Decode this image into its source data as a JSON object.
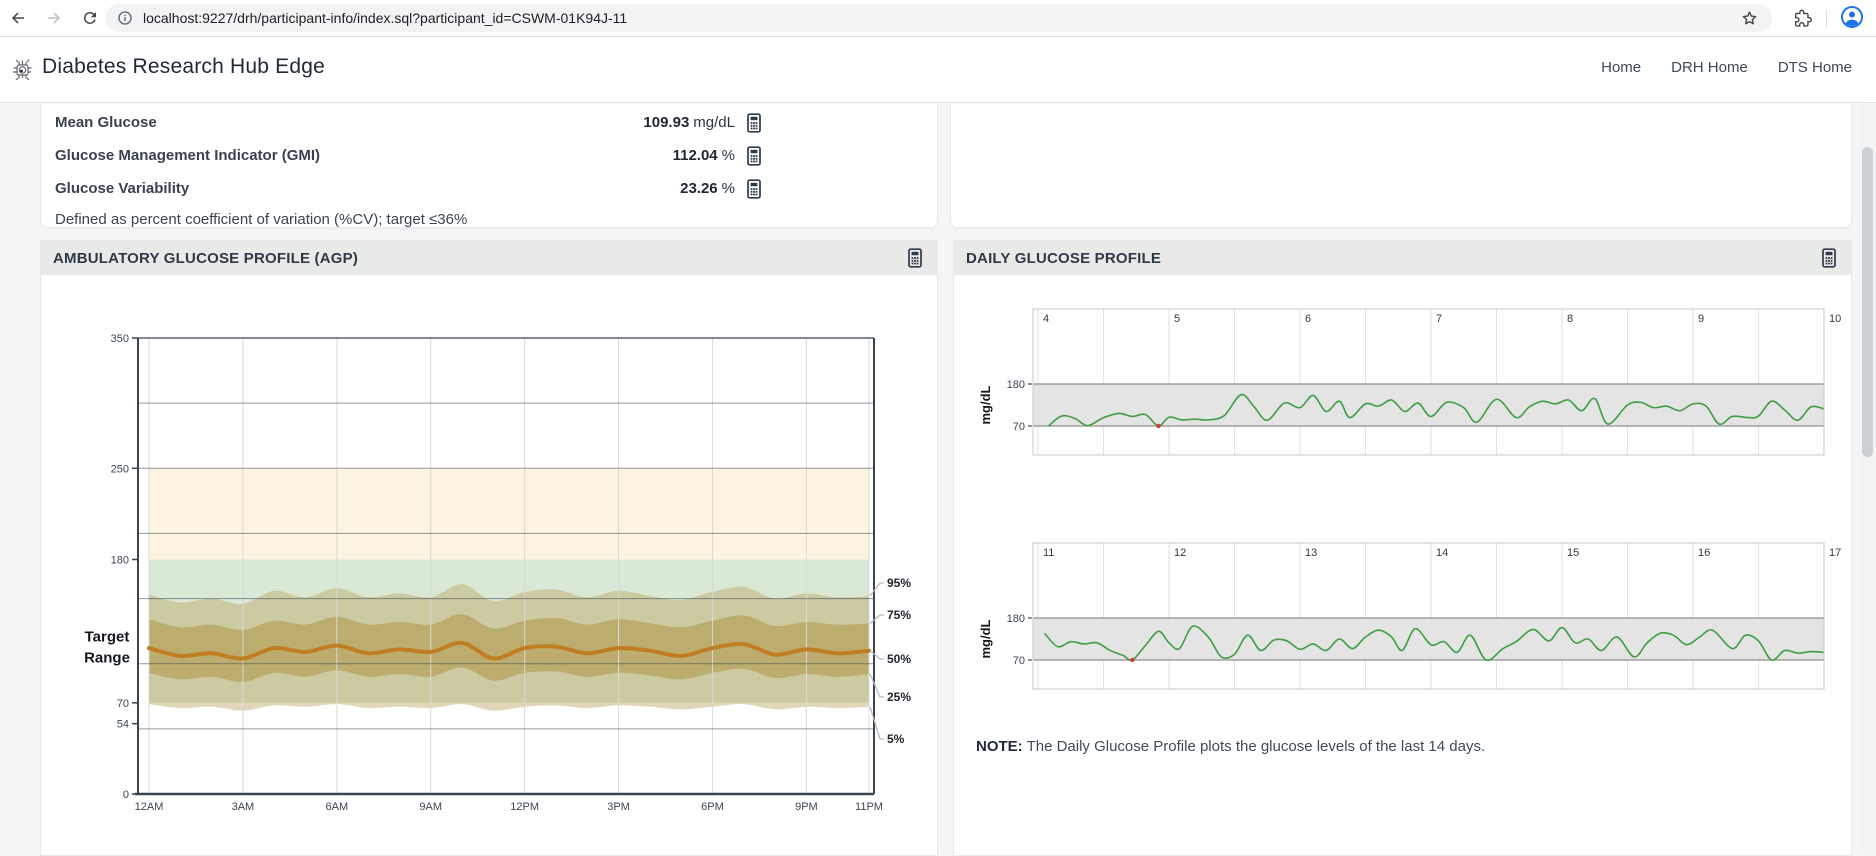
{
  "browser": {
    "url": "localhost:9227/drh/participant-info/index.sql?participant_id=CSWM-01K94J-11",
    "icons": [
      "back-arrow",
      "forward-arrow",
      "reload",
      "site-info",
      "bookmark-star",
      "extensions",
      "profile"
    ]
  },
  "header": {
    "title": "Diabetes Research Hub Edge",
    "logo_icon": "chip-logo",
    "nav": [
      {
        "label": "Home"
      },
      {
        "label": "DRH Home"
      },
      {
        "label": "DTS Home"
      }
    ]
  },
  "metrics": {
    "rows": [
      {
        "label": "Mean Glucose",
        "value": "109.93",
        "unit": "mg/dL",
        "icon": "calculator"
      },
      {
        "label": "Glucose Management Indicator (GMI)",
        "value": "112.04",
        "unit": "%",
        "icon": "calculator"
      },
      {
        "label": "Glucose Variability",
        "value": "23.26",
        "unit": "%",
        "icon": "calculator"
      }
    ],
    "footnote": "Defined as percent coefficient of variation (%CV); target ≤36%"
  },
  "agp_panel": {
    "title": "AMBULATORY GLUCOSE PROFILE (AGP)",
    "header_icon": "calculator"
  },
  "daily_panel": {
    "title": "DAILY GLUCOSE PROFILE",
    "header_icon": "calculator",
    "note_label": "NOTE:",
    "note_text": " The Daily Glucose Profile plots the glucose levels of the last 14 days."
  },
  "colors": {
    "accent_blue": "#1a73e8",
    "daily_line_green": "#3f9e42",
    "median_brown": "#c07d21",
    "target_green_fill": "#d9e9d5",
    "above_target_fill": "#fcf3e1",
    "outer_band_fill": "rgba(188,164,96,0.45)",
    "inner_band_fill": "rgba(172,144,62,0.50)",
    "daily_band_fill": "#e4e4e4",
    "low_point_red": "#d23b3b"
  },
  "chart_data": [
    {
      "id": "agp",
      "type": "area",
      "title": "Ambulatory Glucose Profile (AGP)",
      "x_hours": [
        0,
        1,
        2,
        3,
        4,
        5,
        6,
        7,
        8,
        9,
        10,
        11,
        12,
        13,
        14,
        15,
        16,
        17,
        18,
        19,
        20,
        21,
        22,
        23
      ],
      "xticks": [
        {
          "hour": 0,
          "label": "12AM"
        },
        {
          "hour": 3,
          "label": "3AM"
        },
        {
          "hour": 6,
          "label": "6AM"
        },
        {
          "hour": 9,
          "label": "9AM"
        },
        {
          "hour": 12,
          "label": "12PM"
        },
        {
          "hour": 15,
          "label": "3PM"
        },
        {
          "hour": 18,
          "label": "6PM"
        },
        {
          "hour": 21,
          "label": "9PM"
        },
        {
          "hour": 23,
          "label": "11PM"
        }
      ],
      "ylim": [
        0,
        350
      ],
      "yticks": [
        0,
        54,
        70,
        180,
        250,
        350
      ],
      "gridlines_y": [
        50,
        100,
        150,
        200,
        250,
        300
      ],
      "target_range": [
        70,
        180
      ],
      "above_target_band": [
        180,
        250
      ],
      "target_label": [
        "Target",
        "Range"
      ],
      "percentile_labels": [
        "95%",
        "75%",
        "50%",
        "25%",
        "5%"
      ],
      "series": [
        {
          "name": "5%",
          "values": [
            69,
            66,
            67,
            64,
            68,
            67,
            69,
            66,
            67,
            66,
            69,
            64,
            67,
            68,
            66,
            68,
            67,
            65,
            67,
            69,
            65,
            67,
            66,
            67
          ]
        },
        {
          "name": "25%",
          "values": [
            93,
            88,
            90,
            86,
            93,
            90,
            95,
            90,
            92,
            90,
            97,
            87,
            93,
            94,
            90,
            93,
            91,
            88,
            93,
            96,
            89,
            92,
            90,
            92
          ]
        },
        {
          "name": "50%",
          "values": [
            112,
            106,
            108,
            104,
            112,
            109,
            114,
            108,
            111,
            109,
            116,
            104,
            112,
            113,
            108,
            112,
            110,
            106,
            112,
            115,
            107,
            111,
            108,
            110
          ]
        },
        {
          "name": "75%",
          "values": [
            134,
            128,
            130,
            126,
            133,
            130,
            136,
            130,
            132,
            130,
            138,
            127,
            133,
            135,
            130,
            134,
            131,
            128,
            133,
            137,
            129,
            132,
            130,
            131
          ]
        },
        {
          "name": "95%",
          "values": [
            153,
            147,
            150,
            146,
            156,
            151,
            158,
            151,
            154,
            151,
            161,
            148,
            155,
            157,
            151,
            156,
            152,
            149,
            155,
            159,
            150,
            154,
            151,
            152
          ]
        }
      ]
    },
    {
      "id": "daily-1",
      "type": "line",
      "ylabel": "mg/dL",
      "yticks": [
        70,
        180
      ],
      "target_band": [
        70,
        180
      ],
      "days": [
        4,
        5,
        6,
        7,
        8,
        9,
        10
      ],
      "points": [
        [
          4.08,
          70
        ],
        [
          4.18,
          96
        ],
        [
          4.28,
          90
        ],
        [
          4.38,
          71
        ],
        [
          4.5,
          92
        ],
        [
          4.62,
          103
        ],
        [
          4.72,
          95
        ],
        [
          4.82,
          100
        ],
        [
          4.92,
          70
        ],
        [
          5.0,
          93
        ],
        [
          5.1,
          86
        ],
        [
          5.2,
          88
        ],
        [
          5.3,
          86
        ],
        [
          5.42,
          97
        ],
        [
          5.55,
          152
        ],
        [
          5.65,
          120
        ],
        [
          5.75,
          85
        ],
        [
          5.88,
          130
        ],
        [
          6.0,
          118
        ],
        [
          6.1,
          150
        ],
        [
          6.2,
          108
        ],
        [
          6.3,
          135
        ],
        [
          6.38,
          92
        ],
        [
          6.5,
          128
        ],
        [
          6.6,
          122
        ],
        [
          6.7,
          138
        ],
        [
          6.8,
          108
        ],
        [
          6.9,
          130
        ],
        [
          7.0,
          95
        ],
        [
          7.12,
          132
        ],
        [
          7.25,
          118
        ],
        [
          7.35,
          80
        ],
        [
          7.5,
          140
        ],
        [
          7.65,
          92
        ],
        [
          7.75,
          120
        ],
        [
          7.85,
          135
        ],
        [
          7.95,
          128
        ],
        [
          8.05,
          138
        ],
        [
          8.15,
          110
        ],
        [
          8.25,
          142
        ],
        [
          8.35,
          75
        ],
        [
          8.5,
          125
        ],
        [
          8.6,
          132
        ],
        [
          8.7,
          118
        ],
        [
          8.8,
          122
        ],
        [
          8.9,
          110
        ],
        [
          9.0,
          128
        ],
        [
          9.1,
          122
        ],
        [
          9.2,
          75
        ],
        [
          9.3,
          95
        ],
        [
          9.42,
          92
        ],
        [
          9.5,
          96
        ],
        [
          9.6,
          135
        ],
        [
          9.7,
          112
        ],
        [
          9.8,
          85
        ],
        [
          9.9,
          120
        ],
        [
          10.0,
          115
        ]
      ],
      "low_points": [
        [
          4.92,
          70
        ]
      ]
    },
    {
      "id": "daily-2",
      "type": "line",
      "ylabel": "mg/dL",
      "yticks": [
        70,
        180
      ],
      "target_band": [
        70,
        180
      ],
      "days": [
        11,
        12,
        13,
        14,
        15,
        16,
        17
      ],
      "points": [
        [
          11.05,
          140
        ],
        [
          11.15,
          105
        ],
        [
          11.25,
          118
        ],
        [
          11.35,
          112
        ],
        [
          11.45,
          115
        ],
        [
          11.55,
          95
        ],
        [
          11.65,
          82
        ],
        [
          11.72,
          70
        ],
        [
          11.82,
          108
        ],
        [
          11.92,
          145
        ],
        [
          12.0,
          115
        ],
        [
          12.08,
          100
        ],
        [
          12.18,
          158
        ],
        [
          12.3,
          130
        ],
        [
          12.4,
          78
        ],
        [
          12.5,
          85
        ],
        [
          12.6,
          135
        ],
        [
          12.7,
          95
        ],
        [
          12.8,
          122
        ],
        [
          12.9,
          120
        ],
        [
          13.0,
          98
        ],
        [
          13.1,
          112
        ],
        [
          13.2,
          95
        ],
        [
          13.3,
          125
        ],
        [
          13.4,
          100
        ],
        [
          13.5,
          130
        ],
        [
          13.6,
          148
        ],
        [
          13.7,
          130
        ],
        [
          13.78,
          95
        ],
        [
          13.88,
          152
        ],
        [
          14.0,
          110
        ],
        [
          14.1,
          118
        ],
        [
          14.2,
          90
        ],
        [
          14.3,
          135
        ],
        [
          14.42,
          70
        ],
        [
          14.55,
          100
        ],
        [
          14.65,
          118
        ],
        [
          14.78,
          150
        ],
        [
          14.9,
          120
        ],
        [
          15.0,
          155
        ],
        [
          15.1,
          115
        ],
        [
          15.2,
          125
        ],
        [
          15.3,
          95
        ],
        [
          15.42,
          130
        ],
        [
          15.55,
          78
        ],
        [
          15.65,
          115
        ],
        [
          15.75,
          140
        ],
        [
          15.85,
          135
        ],
        [
          15.95,
          110
        ],
        [
          16.05,
          130
        ],
        [
          16.15,
          148
        ],
        [
          16.3,
          100
        ],
        [
          16.4,
          135
        ],
        [
          16.5,
          120
        ],
        [
          16.6,
          70
        ],
        [
          16.7,
          95
        ],
        [
          16.8,
          88
        ],
        [
          16.9,
          92
        ],
        [
          17.0,
          90
        ]
      ],
      "low_points": [
        [
          11.72,
          70
        ]
      ]
    }
  ]
}
